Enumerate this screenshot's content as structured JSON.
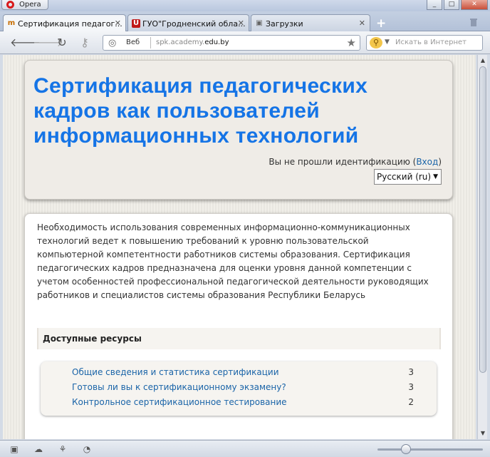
{
  "browser": {
    "app_name": "Opera",
    "tabs": [
      {
        "label": "Сертификация педагог...",
        "favicon": "m",
        "active": true
      },
      {
        "label": "ГУО\"Гродненский обла...",
        "favicon": "U",
        "active": false
      },
      {
        "label": "Загрузки",
        "favicon": "download",
        "active": false
      }
    ],
    "address": {
      "scheme_label": "Веб",
      "url_prefix": "spk.academy.",
      "url_domain": "edu.by"
    },
    "search_placeholder": "Искать в Интернет"
  },
  "page": {
    "title": "Сертификация педагогических кадров как пользователей информационных технологий",
    "login_text": "Вы не прошли идентификацию (",
    "login_link": "Вход",
    "login_close": ")",
    "language": "Русский (ru)",
    "intro": "Необходимость использования современных информационно-коммуникационных технологий ведет к повышению требований к уровню пользовательской компьютерной компетентности работников системы образования. Сертификация педагогических кадров предназначена для оценки уровня данной компетенции с учетом особенностей профессиональной педагогической деятельности руководящих работников и специалистов системы образования Республики Беларусь",
    "resources_heading": "Доступные ресурсы",
    "resources": [
      {
        "label": "Общие сведения и статистика сертификации",
        "count": "3"
      },
      {
        "label": "Готовы ли вы к сертификационному экзамену?",
        "count": "3"
      },
      {
        "label": "Контрольное сертификационное тестирование",
        "count": "2"
      }
    ]
  },
  "colors": {
    "title_blue": "#1574e6",
    "link_blue": "#1a64a8"
  }
}
